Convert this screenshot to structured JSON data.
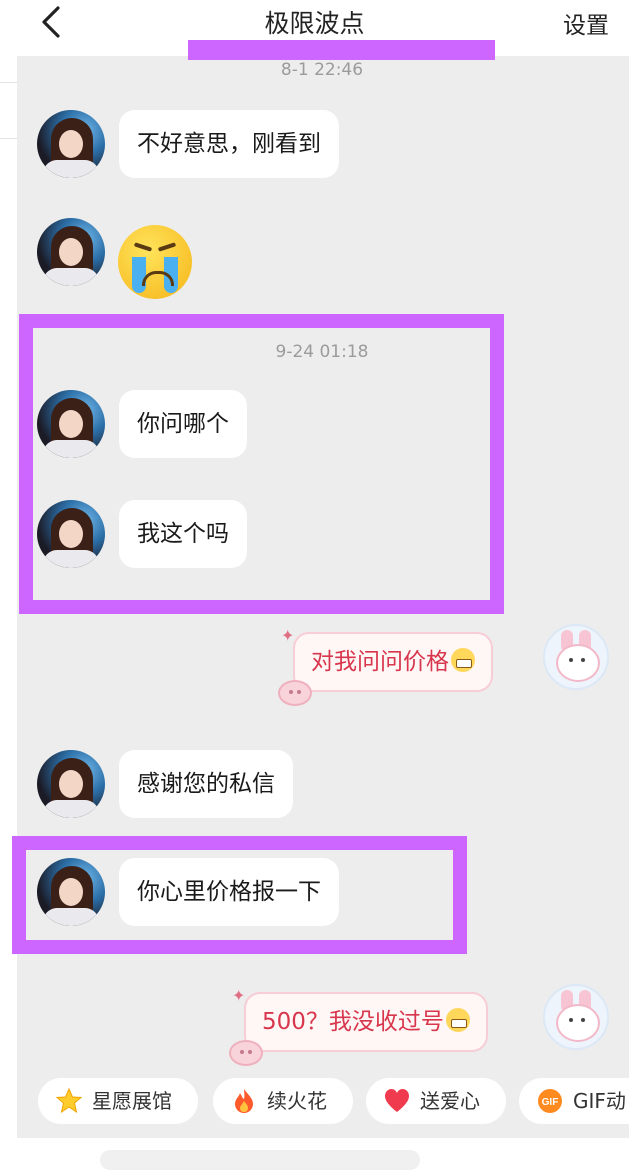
{
  "header": {
    "title": "极限波点",
    "settings_label": "设置"
  },
  "messages": {
    "ts1": "8-1  22:46",
    "m1": "不好意思，刚看到",
    "ts2": "9-24  01:18",
    "m2": "你问哪个",
    "m3": "我这个吗",
    "r1": "对我问问价格",
    "m4": "感谢您的私信",
    "m5": "你心里价格报一下",
    "r2": "500？我没收过号"
  },
  "quick_actions": [
    {
      "label": "星愿展馆",
      "icon": "star-icon"
    },
    {
      "label": "续火花",
      "icon": "fire-icon"
    },
    {
      "label": "送爱心",
      "icon": "heart-icon"
    },
    {
      "label": "GIF动",
      "icon": "gif-icon"
    }
  ],
  "colors": {
    "annotation": "#cc66ff",
    "chat_background": "#ededed",
    "sent_text": "#d8364c"
  }
}
